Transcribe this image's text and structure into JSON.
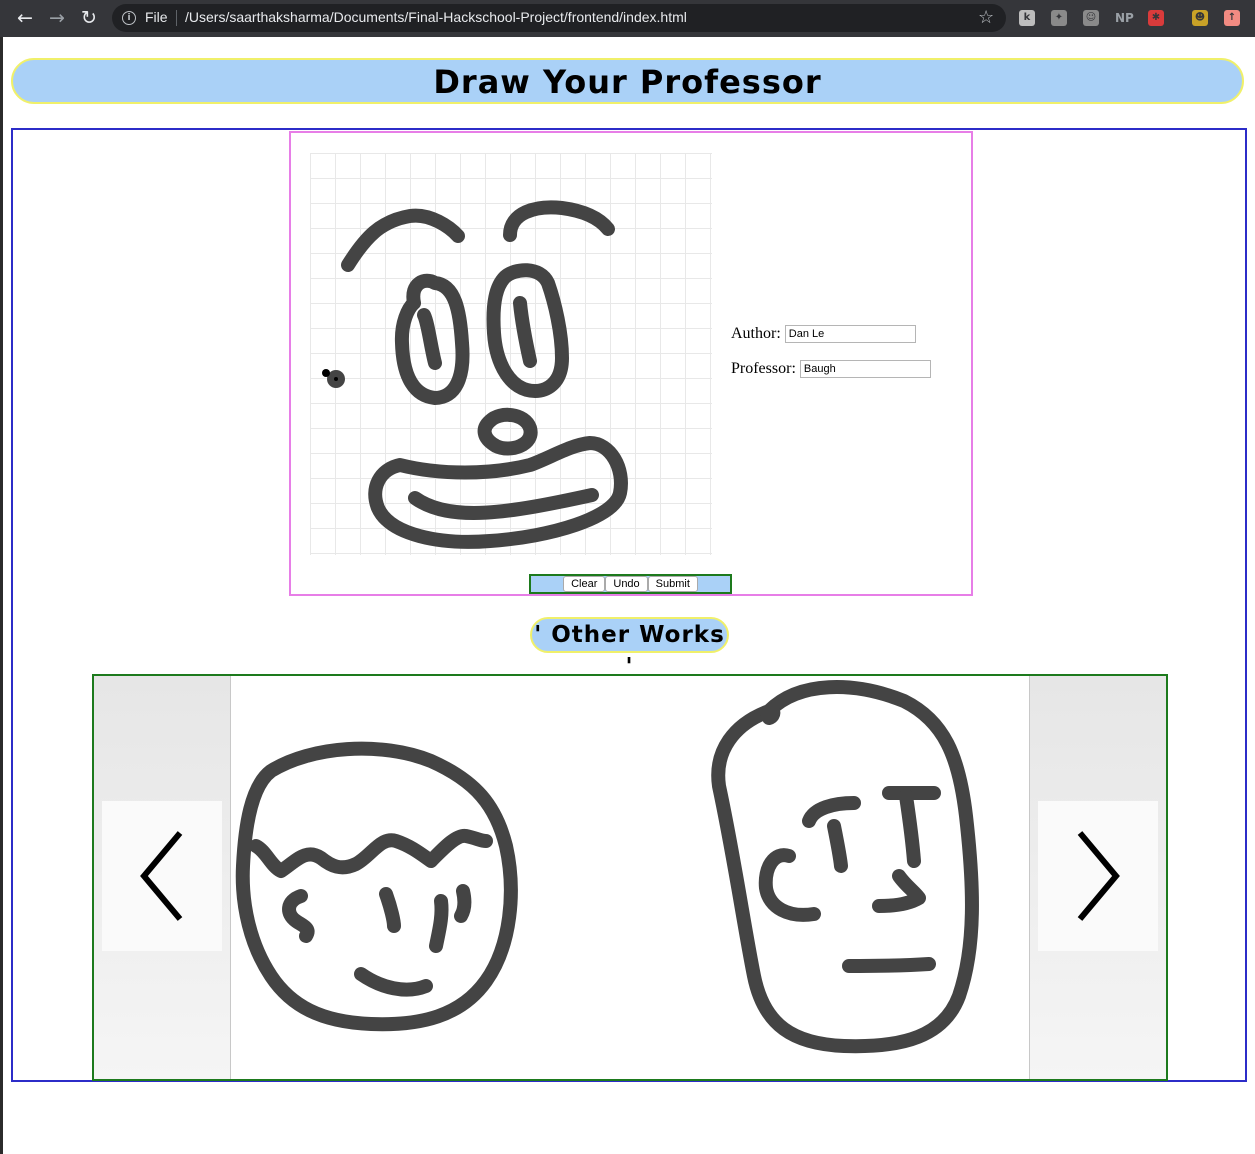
{
  "browser": {
    "back_icon": "arrow-left-icon",
    "forward_icon": "arrow-right-icon",
    "reload_icon": "reload-icon",
    "scheme_label": "File",
    "url": "/Users/saarthaksharma/Documents/Final-Hackschool-Project/frontend/index.html",
    "extensions": [
      {
        "icon": "ext-k-icon",
        "glyph": "k",
        "color": "#bdbdbd"
      },
      {
        "icon": "ext-paw-icon",
        "glyph": "✦",
        "color": "#8a8a8a"
      },
      {
        "icon": "ext-discord-icon",
        "glyph": "☺",
        "color": "#8a8a8a"
      },
      {
        "icon": "ext-np-icon",
        "glyph": "NP",
        "color": "#35363a"
      },
      {
        "icon": "ext-shield-icon",
        "glyph": "✱",
        "color": "#d93b3b"
      },
      {
        "icon": "ext-avatar-icon",
        "glyph": "☻",
        "color": "#c9a227"
      },
      {
        "icon": "ext-update-icon",
        "glyph": "↑",
        "color": "#f28b82"
      }
    ]
  },
  "header": {
    "title": "Draw Your Professor"
  },
  "form": {
    "author_label": "Author:",
    "author_value": "Dan Le",
    "professor_label": "Professor:",
    "professor_value": "Baugh"
  },
  "buttons": {
    "clear": "Clear",
    "undo": "Undo",
    "submit": "Submit"
  },
  "other_works": {
    "title": "' Other Works '"
  },
  "carousel": {
    "prev_icon": "chevron-left-icon",
    "next_icon": "chevron-right-icon"
  },
  "colors": {
    "accent": "#aad1f7",
    "header_border": "#f0f06a",
    "main_border": "#2c2cc8",
    "draw_border": "#e77ee7",
    "green_border": "#1d7a1d",
    "stroke": "#444444"
  }
}
